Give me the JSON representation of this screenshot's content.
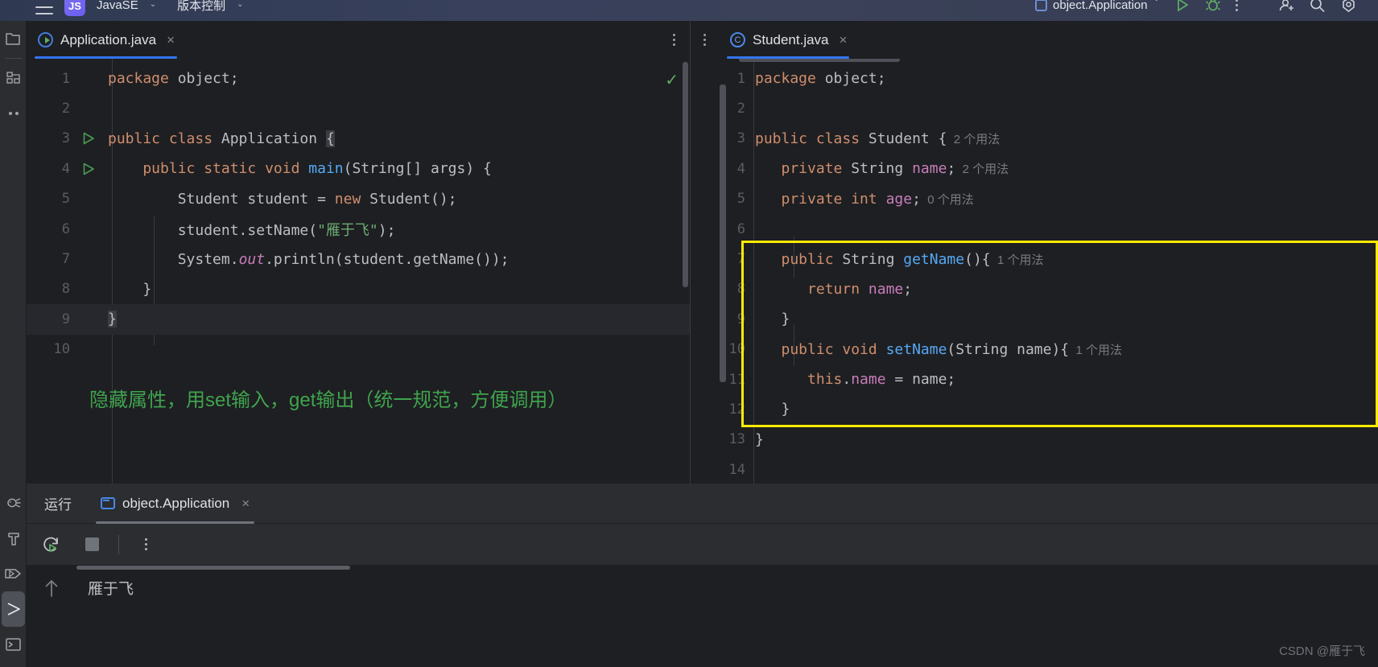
{
  "topbar": {
    "menu_icon": "hamburger-icon",
    "project_badge": "JS",
    "project_name": "JavaSE",
    "vcs_label": "版本控制",
    "run_config": "object.Application",
    "icons": [
      "run-icon",
      "debug-icon",
      "more-options-icon",
      "add-user-icon",
      "search-icon",
      "settings-icon"
    ]
  },
  "left_strip": {
    "items": [
      {
        "name": "project-icon",
        "glyph": "folder"
      },
      {
        "name": "structure-icon",
        "glyph": "structure"
      },
      {
        "name": "more-tool-windows-icon",
        "glyph": "dots"
      },
      {
        "name": "debug-icon",
        "glyph": "bug"
      },
      {
        "name": "build-icon",
        "glyph": "hammer"
      },
      {
        "name": "run-icon",
        "glyph": "play"
      },
      {
        "name": "services-icon",
        "glyph": "play-filled"
      },
      {
        "name": "terminal-icon",
        "glyph": "terminal"
      }
    ]
  },
  "left_editor": {
    "tab_label": "Application.java",
    "tab_close": "×",
    "tab_icon": "java-runnable-class-icon",
    "overflow_icon": "more-tabs-icon",
    "inspection_status": "✓",
    "line_numbers": [
      "1",
      "2",
      "3",
      "4",
      "5",
      "6",
      "7",
      "8",
      "9",
      "10"
    ],
    "code_lines": [
      {
        "n": "1",
        "runmark": false,
        "tokens": [
          {
            "t": "package",
            "c": "kw"
          },
          {
            "t": " object;",
            "c": "def"
          }
        ]
      },
      {
        "n": "2",
        "runmark": false,
        "tokens": []
      },
      {
        "n": "3",
        "runmark": true,
        "tokens": [
          {
            "t": "public class",
            "c": "kw"
          },
          {
            "t": " Application ",
            "c": "def"
          },
          {
            "t": "{",
            "c": "brmatch"
          }
        ]
      },
      {
        "n": "4",
        "runmark": true,
        "tokens": [
          {
            "t": "    public static void",
            "c": "kw"
          },
          {
            "t": " ",
            "c": "def"
          },
          {
            "t": "main",
            "c": "mth"
          },
          {
            "t": "(String[] args) {",
            "c": "def"
          }
        ]
      },
      {
        "n": "5",
        "runmark": false,
        "tokens": [
          {
            "t": "        Student student = ",
            "c": "def"
          },
          {
            "t": "new",
            "c": "kw"
          },
          {
            "t": " Student();",
            "c": "def"
          }
        ]
      },
      {
        "n": "6",
        "runmark": false,
        "tokens": [
          {
            "t": "        student.setName(",
            "c": "def"
          },
          {
            "t": "\"雁于飞\"",
            "c": "str"
          },
          {
            "t": ");",
            "c": "def"
          }
        ]
      },
      {
        "n": "7",
        "runmark": false,
        "tokens": [
          {
            "t": "        System.",
            "c": "def"
          },
          {
            "t": "out",
            "c": "sta"
          },
          {
            "t": ".println(student.getName());",
            "c": "def"
          }
        ]
      },
      {
        "n": "8",
        "runmark": false,
        "tokens": [
          {
            "t": "    }",
            "c": "def"
          }
        ]
      },
      {
        "n": "9",
        "runmark": false,
        "current": true,
        "tokens": [
          {
            "t": "}",
            "c": "brmatch"
          }
        ]
      },
      {
        "n": "10",
        "runmark": false,
        "tokens": []
      }
    ],
    "annotation": "隐藏属性，用set输入，get输出（统一规范，方便调用）"
  },
  "right_editor": {
    "tab_label": "Student.java",
    "tab_close": "×",
    "tab_icon": "java-class-icon",
    "overflow_icon": "more-tabs-icon",
    "code_lines": [
      {
        "n": "1",
        "tokens": [
          {
            "t": "package",
            "c": "kw"
          },
          {
            "t": " object;",
            "c": "def"
          }
        ]
      },
      {
        "n": "2",
        "tokens": []
      },
      {
        "n": "3",
        "tokens": [
          {
            "t": "public class",
            "c": "kw"
          },
          {
            "t": " Student {",
            "c": "def"
          },
          {
            "t": "  2 个用法",
            "c": "hint"
          }
        ]
      },
      {
        "n": "4",
        "tokens": [
          {
            "t": "   private",
            "c": "kw"
          },
          {
            "t": " String ",
            "c": "def"
          },
          {
            "t": "name",
            "c": "fld"
          },
          {
            "t": ";",
            "c": "def"
          },
          {
            "t": "  2 个用法",
            "c": "hint"
          }
        ]
      },
      {
        "n": "5",
        "tokens": [
          {
            "t": "   private int",
            "c": "kw"
          },
          {
            "t": " ",
            "c": "def"
          },
          {
            "t": "age",
            "c": "fld"
          },
          {
            "t": ";",
            "c": "def"
          },
          {
            "t": "  0 个用法",
            "c": "hint"
          }
        ]
      },
      {
        "n": "6",
        "tokens": []
      },
      {
        "n": "7",
        "tokens": [
          {
            "t": "   public",
            "c": "kw"
          },
          {
            "t": " String ",
            "c": "def"
          },
          {
            "t": "getName",
            "c": "mth"
          },
          {
            "t": "(){",
            "c": "def"
          },
          {
            "t": "  1 个用法",
            "c": "hint"
          }
        ]
      },
      {
        "n": "8",
        "tokens": [
          {
            "t": "      return",
            "c": "kw"
          },
          {
            "t": " ",
            "c": "def"
          },
          {
            "t": "name",
            "c": "fld"
          },
          {
            "t": ";",
            "c": "def"
          }
        ]
      },
      {
        "n": "9",
        "tokens": [
          {
            "t": "   }",
            "c": "def"
          }
        ]
      },
      {
        "n": "10",
        "tokens": [
          {
            "t": "   public void",
            "c": "kw"
          },
          {
            "t": " ",
            "c": "def"
          },
          {
            "t": "setName",
            "c": "mth"
          },
          {
            "t": "(String name){",
            "c": "def"
          },
          {
            "t": "  1 个用法",
            "c": "hint"
          }
        ]
      },
      {
        "n": "11",
        "tokens": [
          {
            "t": "      this",
            "c": "kw"
          },
          {
            "t": ".",
            "c": "def"
          },
          {
            "t": "name",
            "c": "fld"
          },
          {
            "t": " = name;",
            "c": "def"
          }
        ]
      },
      {
        "n": "12",
        "tokens": [
          {
            "t": "   }",
            "c": "def"
          }
        ]
      },
      {
        "n": "13",
        "tokens": [
          {
            "t": "}",
            "c": "def"
          }
        ]
      },
      {
        "n": "14",
        "tokens": []
      }
    ],
    "highlight_box_color": "#FFEB00"
  },
  "run_panel": {
    "title": "运行",
    "tab_label": "object.Application",
    "tab_close": "×",
    "tab_icon": "run-window-icon",
    "toolbar": {
      "rerun": "rerun-icon",
      "stop": "stop-icon",
      "more": "more-options-icon"
    },
    "gutter_icon": "scroll-up-icon",
    "output": "雁于飞"
  },
  "watermark": "CSDN @雁于飞",
  "colors": {
    "accent_blue": "#3574F0",
    "keyword_orange": "#CF8E6D",
    "string_green": "#6AAB73",
    "field_purple": "#C77DBB",
    "method_blue": "#56A8F5",
    "annotation_green": "#3FA34D",
    "highlight_yellow": "#FFEB00",
    "editor_bg": "#1E1F22",
    "panel_bg": "#2B2D30"
  }
}
